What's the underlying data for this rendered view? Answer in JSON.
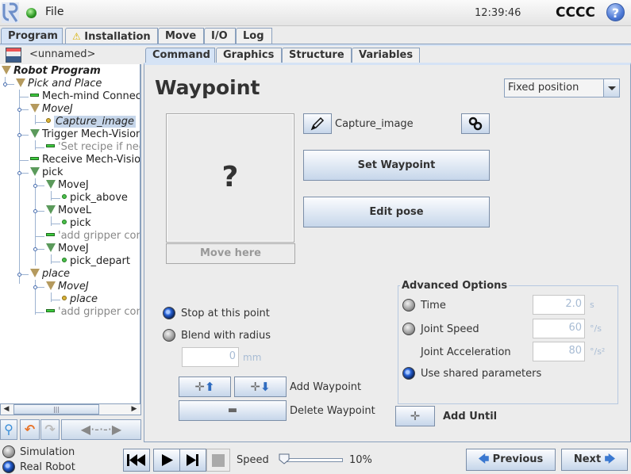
{
  "header": {
    "menu_label": "File",
    "clock": "12:39:46",
    "robot_name": "CCCC",
    "help_label": "?"
  },
  "main_tabs": [
    {
      "label": "Program",
      "active": true
    },
    {
      "label": "Installation",
      "warning": true
    },
    {
      "label": "Move"
    },
    {
      "label": "I/O"
    },
    {
      "label": "Log"
    }
  ],
  "program": {
    "name": "<unnamed>",
    "tree": [
      {
        "label": "Robot Program"
      },
      {
        "label": "Pick and Place"
      },
      {
        "label": "Mech-mind Connect"
      },
      {
        "label": "MoveJ"
      },
      {
        "label": "Capture_image",
        "selected": true
      },
      {
        "label": "Trigger Mech-Vision"
      },
      {
        "label": "'Set recipe if nee"
      },
      {
        "label": "Receive Mech-Vision"
      },
      {
        "label": "pick"
      },
      {
        "label": "MoveJ"
      },
      {
        "label": "pick_above"
      },
      {
        "label": "MoveL"
      },
      {
        "label": "pick"
      },
      {
        "label": "'add gripper cont"
      },
      {
        "label": "MoveJ"
      },
      {
        "label": "pick_depart"
      },
      {
        "label": "place"
      },
      {
        "label": "MoveJ"
      },
      {
        "label": "place"
      },
      {
        "label": "'add gripper cont"
      }
    ]
  },
  "sub_tabs": [
    {
      "label": "Command",
      "active": true
    },
    {
      "label": "Graphics"
    },
    {
      "label": "Structure"
    },
    {
      "label": "Variables"
    }
  ],
  "waypoint": {
    "title": "Waypoint",
    "position_mode": "Fixed position",
    "preview_placeholder": "?",
    "move_here_label": "Move here",
    "name": "Capture_image",
    "set_waypoint_label": "Set Waypoint",
    "edit_pose_label": "Edit pose",
    "stop_label": "Stop at this point",
    "blend_label": "Blend with radius",
    "blend_value": "0",
    "blend_unit": "mm",
    "stop_selected": true,
    "add_waypoint_label": "Add Waypoint",
    "delete_waypoint_label": "Delete Waypoint",
    "add_until_label": "Add Until"
  },
  "advanced": {
    "title": "Advanced Options",
    "time_label": "Time",
    "time_value": "2.0",
    "time_unit": "s",
    "joint_speed_label": "Joint Speed",
    "joint_speed_value": "60",
    "joint_speed_unit": "°/s",
    "joint_accel_label": "Joint Acceleration",
    "joint_accel_value": "80",
    "joint_accel_unit": "°/s²",
    "shared_label": "Use shared parameters",
    "shared_selected": true
  },
  "footer": {
    "simulation_label": "Simulation",
    "real_robot_label": "Real Robot",
    "real_robot_selected": true,
    "speed_label": "Speed",
    "speed_value": "10%",
    "speed_fraction": 0.1,
    "previous_label": "Previous",
    "next_label": "Next"
  },
  "colors": {
    "accent": "#d5e3f5",
    "border": "#8aa0bd",
    "selection": "#c6d6ea"
  }
}
